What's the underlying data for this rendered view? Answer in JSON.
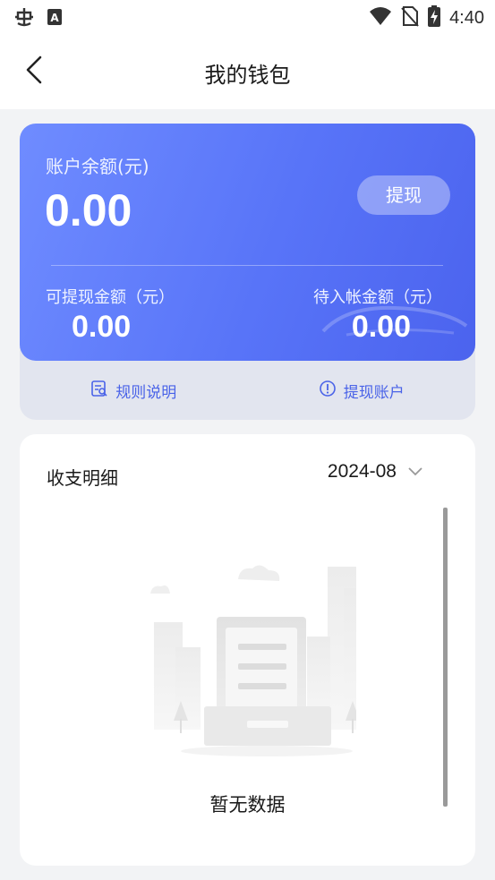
{
  "status_bar": {
    "time": "4:40",
    "left_icons": [
      "bug-icon",
      "text-a-icon"
    ],
    "right_icons": [
      "wifi-icon",
      "no-sim-icon",
      "battery-charging-icon"
    ]
  },
  "header": {
    "title": "我的钱包",
    "back_icon": "chevron-left-icon"
  },
  "wallet": {
    "balance_label": "账户余额(元)",
    "balance_value": "0.00",
    "withdraw_button": "提现",
    "available_label": "可提现金额（元）",
    "available_value": "0.00",
    "pending_label": "待入帐金额（元）",
    "pending_value": "0.00",
    "colors": {
      "gradient_start": "#6f8cff",
      "gradient_end": "#4b63ee",
      "link": "#4a63e8"
    }
  },
  "links": {
    "rules": {
      "label": "规则说明",
      "icon": "rules-document-icon"
    },
    "account": {
      "label": "提现账户",
      "icon": "info-circle-icon"
    }
  },
  "details": {
    "title": "收支明细",
    "month": "2024-08",
    "dropdown_icon": "chevron-down-icon",
    "empty_text": "暂无数据",
    "empty_icon": "empty-document-illustration"
  }
}
